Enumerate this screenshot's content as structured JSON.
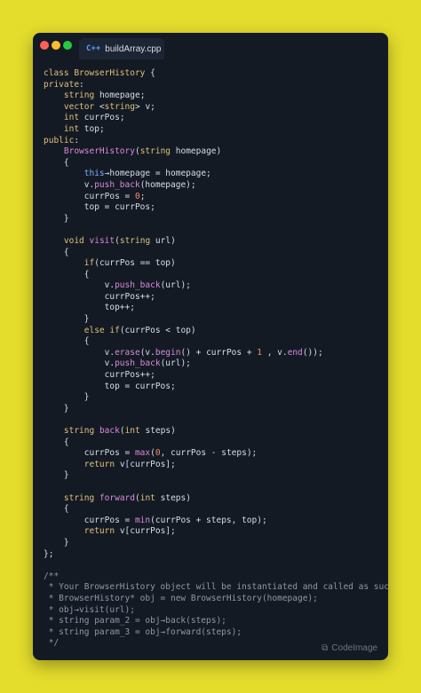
{
  "window": {
    "tab_icon": "C++",
    "tab_label": "buildArray.cpp"
  },
  "watermark": {
    "icon": "codeimage-logo-icon",
    "label": "CodeImage"
  },
  "code_lines": [
    [
      [
        "kw",
        "class "
      ],
      [
        "ty",
        "BrowserHistory"
      ],
      [
        "plain",
        " {"
      ]
    ],
    [
      [
        "kw",
        "private"
      ],
      [
        "plain",
        ":"
      ]
    ],
    [
      [
        "plain",
        "    "
      ],
      [
        "kw",
        "string"
      ],
      [
        "plain",
        " homepage;"
      ]
    ],
    [
      [
        "plain",
        "    "
      ],
      [
        "kw",
        "vector"
      ],
      [
        "plain",
        " <"
      ],
      [
        "kw",
        "string"
      ],
      [
        "plain",
        "> v;"
      ]
    ],
    [
      [
        "plain",
        "    "
      ],
      [
        "kw",
        "int"
      ],
      [
        "plain",
        " currPos;"
      ]
    ],
    [
      [
        "plain",
        "    "
      ],
      [
        "kw",
        "int"
      ],
      [
        "plain",
        " top;"
      ]
    ],
    [
      [
        "kw",
        "public"
      ],
      [
        "plain",
        ":"
      ]
    ],
    [
      [
        "plain",
        "    "
      ],
      [
        "fn",
        "BrowserHistory"
      ],
      [
        "plain",
        "("
      ],
      [
        "kw",
        "string"
      ],
      [
        "plain",
        " homepage)"
      ]
    ],
    [
      [
        "plain",
        "    {"
      ]
    ],
    [
      [
        "plain",
        "        "
      ],
      [
        "this",
        "this"
      ],
      [
        "plain",
        "→homepage = homepage;"
      ]
    ],
    [
      [
        "plain",
        "        v."
      ],
      [
        "fn",
        "push_back"
      ],
      [
        "plain",
        "(homepage);"
      ]
    ],
    [
      [
        "plain",
        "        currPos = "
      ],
      [
        "num",
        "0"
      ],
      [
        "plain",
        ";"
      ]
    ],
    [
      [
        "plain",
        "        top = currPos;"
      ]
    ],
    [
      [
        "plain",
        "    }"
      ]
    ],
    [
      [
        "plain",
        ""
      ]
    ],
    [
      [
        "plain",
        "    "
      ],
      [
        "kw",
        "void"
      ],
      [
        "plain",
        " "
      ],
      [
        "fn",
        "visit"
      ],
      [
        "plain",
        "("
      ],
      [
        "kw",
        "string"
      ],
      [
        "plain",
        " url)"
      ]
    ],
    [
      [
        "plain",
        "    {"
      ]
    ],
    [
      [
        "plain",
        "        "
      ],
      [
        "kw",
        "if"
      ],
      [
        "plain",
        "(currPos == top)"
      ]
    ],
    [
      [
        "plain",
        "        {"
      ]
    ],
    [
      [
        "plain",
        "            v."
      ],
      [
        "fn",
        "push_back"
      ],
      [
        "plain",
        "(url);"
      ]
    ],
    [
      [
        "plain",
        "            currPos++;"
      ]
    ],
    [
      [
        "plain",
        "            top++;"
      ]
    ],
    [
      [
        "plain",
        "        }"
      ]
    ],
    [
      [
        "plain",
        "        "
      ],
      [
        "kw",
        "else if"
      ],
      [
        "plain",
        "(currPos < top)"
      ]
    ],
    [
      [
        "plain",
        "        {"
      ]
    ],
    [
      [
        "plain",
        "            v."
      ],
      [
        "fn",
        "erase"
      ],
      [
        "plain",
        "(v."
      ],
      [
        "fn",
        "begin"
      ],
      [
        "plain",
        "() + currPos + "
      ],
      [
        "num",
        "1"
      ],
      [
        "plain",
        " , v."
      ],
      [
        "fn",
        "end"
      ],
      [
        "plain",
        "());"
      ]
    ],
    [
      [
        "plain",
        "            v."
      ],
      [
        "fn",
        "push_back"
      ],
      [
        "plain",
        "(url);"
      ]
    ],
    [
      [
        "plain",
        "            currPos++;"
      ]
    ],
    [
      [
        "plain",
        "            top = currPos;"
      ]
    ],
    [
      [
        "plain",
        "        }"
      ]
    ],
    [
      [
        "plain",
        "    }"
      ]
    ],
    [
      [
        "plain",
        ""
      ]
    ],
    [
      [
        "plain",
        "    "
      ],
      [
        "kw",
        "string"
      ],
      [
        "plain",
        " "
      ],
      [
        "fn",
        "back"
      ],
      [
        "plain",
        "("
      ],
      [
        "kw",
        "int"
      ],
      [
        "plain",
        " steps)"
      ]
    ],
    [
      [
        "plain",
        "    {"
      ]
    ],
    [
      [
        "plain",
        "        currPos = "
      ],
      [
        "fn",
        "max"
      ],
      [
        "plain",
        "("
      ],
      [
        "num",
        "0"
      ],
      [
        "plain",
        ", currPos - steps);"
      ]
    ],
    [
      [
        "plain",
        "        "
      ],
      [
        "kw",
        "return"
      ],
      [
        "plain",
        " v[currPos];"
      ]
    ],
    [
      [
        "plain",
        "    }"
      ]
    ],
    [
      [
        "plain",
        ""
      ]
    ],
    [
      [
        "plain",
        "    "
      ],
      [
        "kw",
        "string"
      ],
      [
        "plain",
        " "
      ],
      [
        "fn",
        "forward"
      ],
      [
        "plain",
        "("
      ],
      [
        "kw",
        "int"
      ],
      [
        "plain",
        " steps)"
      ]
    ],
    [
      [
        "plain",
        "    {"
      ]
    ],
    [
      [
        "plain",
        "        currPos = "
      ],
      [
        "fn",
        "min"
      ],
      [
        "plain",
        "(currPos + steps, top);"
      ]
    ],
    [
      [
        "plain",
        "        "
      ],
      [
        "kw",
        "return"
      ],
      [
        "plain",
        " v[currPos];"
      ]
    ],
    [
      [
        "plain",
        "    }"
      ]
    ],
    [
      [
        "plain",
        "};"
      ]
    ],
    [
      [
        "plain",
        ""
      ]
    ],
    [
      [
        "cm",
        "/**"
      ]
    ],
    [
      [
        "cm",
        " * Your BrowserHistory object will be instantiated and called as such:"
      ]
    ],
    [
      [
        "cm",
        " * BrowserHistory* obj = new BrowserHistory(homepage);"
      ]
    ],
    [
      [
        "cm",
        " * obj→visit(url);"
      ]
    ],
    [
      [
        "cm",
        " * string param_2 = obj→back(steps);"
      ]
    ],
    [
      [
        "cm",
        " * string param_3 = obj→forward(steps);"
      ]
    ],
    [
      [
        "cm",
        " */"
      ]
    ]
  ]
}
